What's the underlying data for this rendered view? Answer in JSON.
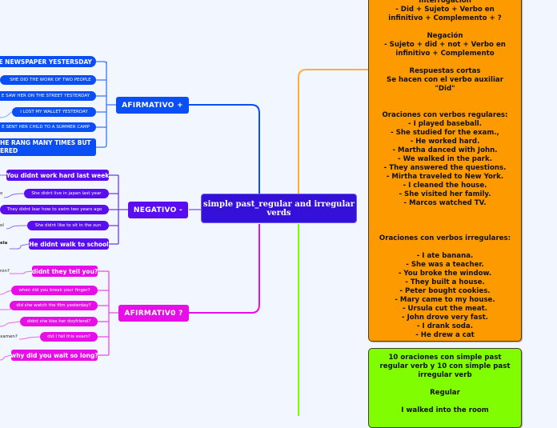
{
  "colors": {
    "background": "#f2f6fe",
    "root": "#3410d9",
    "afirmativo": "#0a4ef5",
    "negativo": "#5a0df0",
    "interrogativo": "#e80ee8",
    "orange_note": "#fd9a00",
    "green_note": "#80fe00"
  },
  "root": {
    "title": "simple past_regular and irregular verds"
  },
  "branches": {
    "afirmativo": {
      "label": "AFIRMATIVO +",
      "children": [
        "HE NEWSPAPER YESTERSDAY",
        "SHE DID THE  WORK OF TWO PEOPLE",
        "E SAW HER ON THE STREET YESTERDAY",
        "I LOST MY WALLET YESTERDAY",
        "E SENT HER CHILD TO A SUMMER CAMP",
        "HE RANG MANY TIMES  BUT",
        "ERED"
      ]
    },
    "negativo": {
      "label": "NEGATIVO -",
      "children": [
        "You didnt work hard last week",
        "She didnt live in japan last year",
        "They  didnt lear how to swim two years ago",
        "She didnt like to sit in the sun",
        "He didnt walk to school"
      ],
      "outer_texts": [
        "o",
        "ol",
        "ela"
      ]
    },
    "interrogativo": {
      "label": "AFIRMATIV0 ?",
      "children": [
        "didnt they tell you?",
        "when did you break your finger?",
        "did she watch the film yesterday?",
        "didnt she kiss her doyfriend?",
        "did I fail this exam?",
        "why did you wait so long?"
      ],
      "outer_texts": [
        "ron?",
        "xamen?"
      ]
    }
  },
  "orange_note": {
    "lines": [
      "Interrogación",
      "- Did + Sujeto + Verbo en",
      "infinitivo + Complemento + ?",
      "",
      "Negación",
      "- Sujeto + did + not + Verbo en",
      "infinitivo + Complemento",
      "",
      "Respuestas cortas",
      "Se hacen con el verbo auxiliar",
      "\"Did\"",
      "",
      "",
      "Oraciones con verbos regulares:",
      "- I played baseball.",
      "- She studied for the exam.,",
      "- He worked hard.",
      "- Martha danced with John.",
      "- We walked in the park.",
      "- They answered the questions.",
      "- Mirtha traveled to New York.",
      "- I cleaned the house.",
      "- She visited her family.",
      "- Marcos watched TV.",
      "",
      "",
      "",
      "Oraciones con verbos irregulares:",
      "",
      "- I ate banana.",
      "- She was a teacher.",
      "- You broke the window.",
      "- They built a house.",
      "- Peter bought cookies.",
      "- Mary came to my house.",
      "- Ursula cut the meat.",
      "- John drove very fast.",
      "- I drank soda.",
      "- He drew a cat"
    ]
  },
  "green_note": {
    "lines": [
      "10 oraciones con simple past",
      "regular verb y 10 con simple past",
      "irregular verb",
      "",
      "Regular",
      "",
      "I walked into the room"
    ]
  }
}
